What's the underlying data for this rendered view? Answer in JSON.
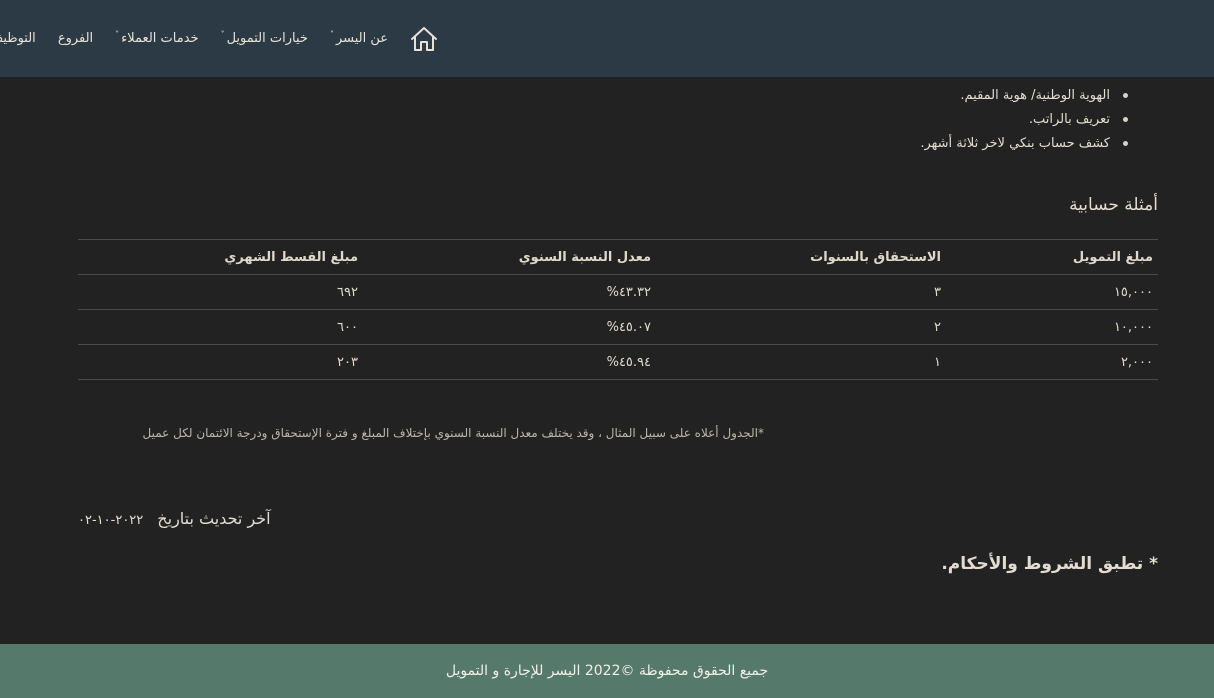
{
  "header": {
    "nav": [
      {
        "label": "عن اليسر",
        "has_dropdown": true
      },
      {
        "label": "خيارات التمويل",
        "has_dropdown": true
      },
      {
        "label": "خدمات العملاء",
        "has_dropdown": true
      },
      {
        "label": "الفروع",
        "has_dropdown": false
      },
      {
        "label": "التوظيف",
        "has_dropdown": false
      }
    ],
    "home_icon": "home-icon",
    "caret_glyph": "˅"
  },
  "documents": [
    "الهوية الوطنية/ هوية المقيم.",
    "تعريف بالراتب.",
    "كشف حساب بنكي لاخر ثلاثة أشهر."
  ],
  "examples": {
    "title": "أمثلة حسابية",
    "headers": [
      "مبلغ التمويل",
      "الاستحقاق بالسنوات",
      "معدل النسبة السنوي",
      "مبلغ القسط الشهري"
    ],
    "rows": [
      [
        "١٥,٠٠٠",
        "٣",
        "٤٣.٣٢%",
        "٦٩٢"
      ],
      [
        "١٠,٠٠٠",
        "٢",
        "٤٥.٠٧%",
        "٦٠٠"
      ],
      [
        "٢,٠٠٠",
        "١",
        "٤٥.٩٤%",
        "٢٠٣"
      ]
    ],
    "note": "*الجدول أعلاه على سبيل المثال ، وقد يختلف معدل النسبة السنوي بإختلاف المبلغ و فترة الإستحقاق ودرجة الائتمان لكل عميل"
  },
  "last_updated": {
    "label": "آخر تحديث بتاريخ",
    "date": "٢٠٢٢-١٠-٠٢"
  },
  "terms": "* تطبق الشروط والأحكام.",
  "footer": {
    "copyright": "جميع الحقوق محفوظة ©2022 اليسر للإجارة و التمويل"
  },
  "colors": {
    "header_bg": "#2b3a44",
    "body_bg": "#222222",
    "footer_bg": "#557a6c",
    "text": "#d9d2c3"
  }
}
